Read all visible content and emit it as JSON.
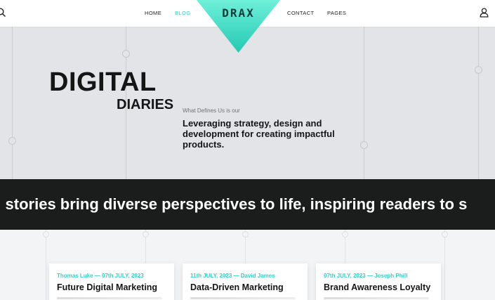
{
  "nav": {
    "links": [
      "HOME",
      "BLOG",
      "CONTACT",
      "PAGES"
    ],
    "active": "BLOG"
  },
  "logo": {
    "text": "DRAX"
  },
  "icons": {
    "search": "search-icon",
    "user": "user-icon"
  },
  "colors": {
    "accent": "#2fd3c4",
    "dark_band": "#1b1c1c",
    "hero_bg": "#e2e4e7"
  },
  "hero": {
    "title_line1": "DIGITAL",
    "title_line2": "DIARIES",
    "kicker": "What Defines Us is our",
    "description": "Leveraging strategy, design and development for creating impactful products."
  },
  "marquee": {
    "text": "g stories bring diverse perspectives to life, inspiring readers to s"
  },
  "posts": [
    {
      "meta": "Thomas Luke — 07th JULY, 2023",
      "title": "Future Digital Marketing"
    },
    {
      "meta": "11th JULY, 2023 — David James",
      "title": "Data-Driven Marketing"
    },
    {
      "meta": "07th JULY, 2023 — Joseph Phill",
      "title": "Brand Awareness Loyalty"
    }
  ]
}
